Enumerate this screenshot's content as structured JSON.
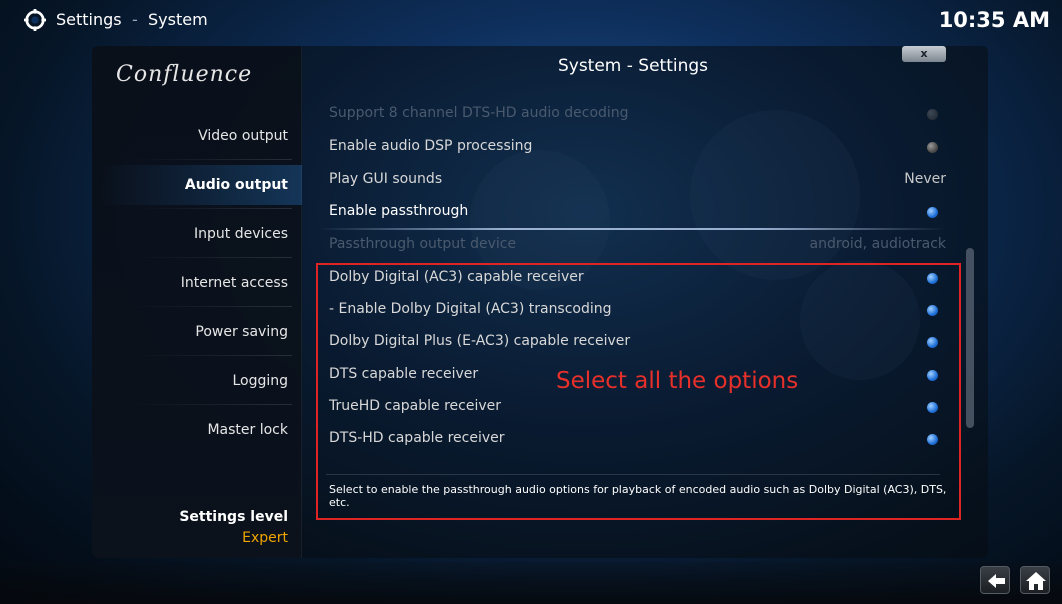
{
  "header": {
    "breadcrumb_root": "Settings",
    "breadcrumb_separator": "-",
    "breadcrumb_current": "System",
    "clock": "10:35 AM"
  },
  "sidebar": {
    "logo": "Confluence",
    "items": [
      {
        "label": "Video output",
        "active": false
      },
      {
        "label": "Audio output",
        "active": true
      },
      {
        "label": "Input devices",
        "active": false
      },
      {
        "label": "Internet access",
        "active": false
      },
      {
        "label": "Power saving",
        "active": false
      },
      {
        "label": "Logging",
        "active": false
      },
      {
        "label": "Master lock",
        "active": false
      }
    ],
    "settings_level_label": "Settings level",
    "settings_level_value": "Expert"
  },
  "content": {
    "title": "System - Settings",
    "close_label": "x",
    "rows": [
      {
        "label": "Support 8 channel DTS-HD audio decoding",
        "state": "disabled"
      },
      {
        "label": "Enable audio DSP processing",
        "state": "off"
      },
      {
        "label": "Play GUI sounds",
        "value": "Never"
      },
      {
        "label": "Enable passthrough",
        "state": "on"
      },
      {
        "label": "Passthrough output device",
        "value": "android, audiotrack",
        "state": "disabled"
      },
      {
        "label": "Dolby Digital (AC3) capable receiver",
        "state": "on"
      },
      {
        "label": "- Enable Dolby Digital (AC3) transcoding",
        "state": "on"
      },
      {
        "label": "Dolby Digital Plus (E-AC3) capable receiver",
        "state": "on"
      },
      {
        "label": "DTS capable receiver",
        "state": "on"
      },
      {
        "label": "TrueHD capable receiver",
        "state": "on"
      },
      {
        "label": "DTS-HD capable receiver",
        "state": "on"
      }
    ],
    "description": "Select to enable the passthrough audio options for playback of encoded audio such as Dolby Digital (AC3), DTS, etc."
  },
  "annotation": {
    "text": "Select all the options",
    "color": "#e02424"
  },
  "colors": {
    "accent": "#1f6fd8",
    "level_value": "#f0a500"
  },
  "footer": {
    "back_icon": "back-arrow-icon",
    "home_icon": "home-icon"
  }
}
